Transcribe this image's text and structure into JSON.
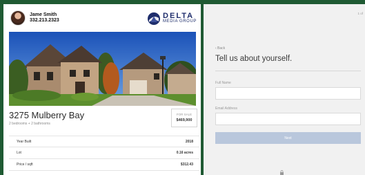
{
  "agent": {
    "name": "Jame Smith",
    "phone": "332.213.2323"
  },
  "logo": {
    "title": "DELTA",
    "subtitle": "MEDIA GROUP",
    "color": "#1e2d6b"
  },
  "listing": {
    "address": "3275 Mulberry Bay",
    "rooms": "2 bedrooms + 2 bathrooms",
    "price_label": "FOR SALE",
    "price_value": "$469,900",
    "facts": [
      {
        "label": "Year Built",
        "value": "2018"
      },
      {
        "label": "Lot",
        "value": "0.16 acres"
      },
      {
        "label": "Price / sqft",
        "value": "$312.43"
      }
    ]
  },
  "form": {
    "page_indicator": "1 of",
    "back": "‹  Back",
    "heading": "Tell us about yourself.",
    "full_name_label": "Full Name",
    "full_name_value": "",
    "email_label": "Email Address",
    "email_value": "",
    "next_label": "Next"
  },
  "colors": {
    "background": "#1f5a33",
    "button": "#b9c7dc",
    "brand": "#1e2d6b"
  }
}
